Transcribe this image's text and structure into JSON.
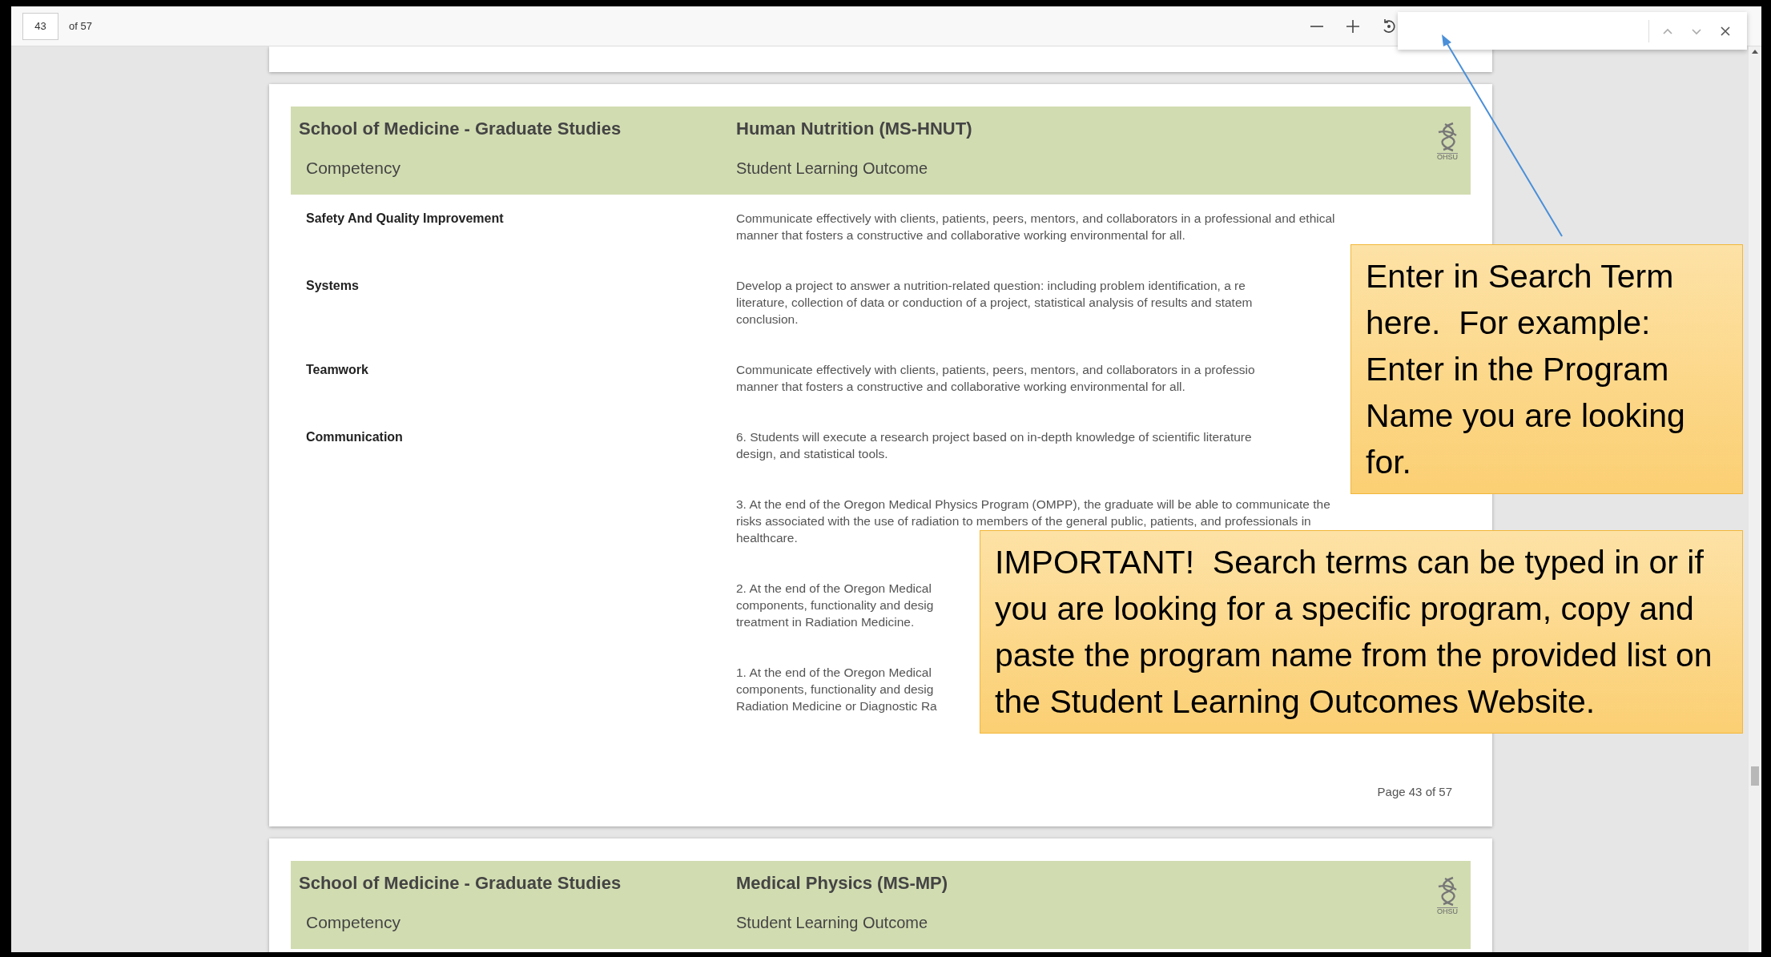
{
  "toolbar": {
    "page_number": "43",
    "page_count": "of 57"
  },
  "pages": [
    {
      "school": "School of Medicine - Graduate Studies",
      "program": "Human Nutrition (MS-HNUT)",
      "competency_heading": "Competency",
      "outcome_heading": "Student Learning Outcome",
      "logo_text": "OHSU",
      "rows": [
        {
          "competency": "Safety And Quality Improvement",
          "outcomes": [
            [
              "Communicate effectively with clients, patients, peers, mentors, and collaborators in a professional and ethical",
              "manner that fosters a constructive and collaborative working environmental for all."
            ]
          ]
        },
        {
          "competency": "Systems",
          "outcomes": [
            [
              "Develop a project to answer a nutrition-related question: including problem identification, a re",
              "literature, collection of data or conduction of a project, statistical analysis of results and statem",
              "conclusion."
            ]
          ]
        },
        {
          "competency": "Teamwork",
          "outcomes": [
            [
              "Communicate effectively with clients, patients, peers, mentors, and collaborators in a professio",
              "manner that fosters a constructive and collaborative working environmental for all."
            ]
          ]
        },
        {
          "competency": "Communication",
          "outcomes": [
            [
              "6. Students will execute a research project based on in-depth knowledge of scientific literature",
              "design, and statistical tools."
            ],
            [
              "3. At the end of the Oregon Medical Physics Program (OMPP), the graduate will be able to communicate the",
              "risks associated with the use of radiation to members of the general public, patients, and professionals in",
              "healthcare."
            ],
            [
              "2. At the end of the Oregon Medical",
              "components, functionality and desig",
              "treatment in Radiation Medicine."
            ],
            [
              "1. At the end of the Oregon Medical",
              "components, functionality and desig",
              "Radiation Medicine or Diagnostic Ra"
            ]
          ]
        }
      ],
      "footer": "Page 43 of 57"
    },
    {
      "school": "School of Medicine - Graduate Studies",
      "program": "Medical Physics (MS-MP)",
      "competency_heading": "Competency",
      "outcome_heading": "Student Learning Outcome",
      "logo_text": "OHSU"
    }
  ],
  "callouts": [
    {
      "text": "Enter in Search Term here.  For example: Enter in the Program Name you are looking for."
    },
    {
      "text": "IMPORTANT!  Search terms can be typed in or if you are looking for a specific program, copy and paste the program name from the provided list on the Student Learning Outcomes Website."
    }
  ]
}
